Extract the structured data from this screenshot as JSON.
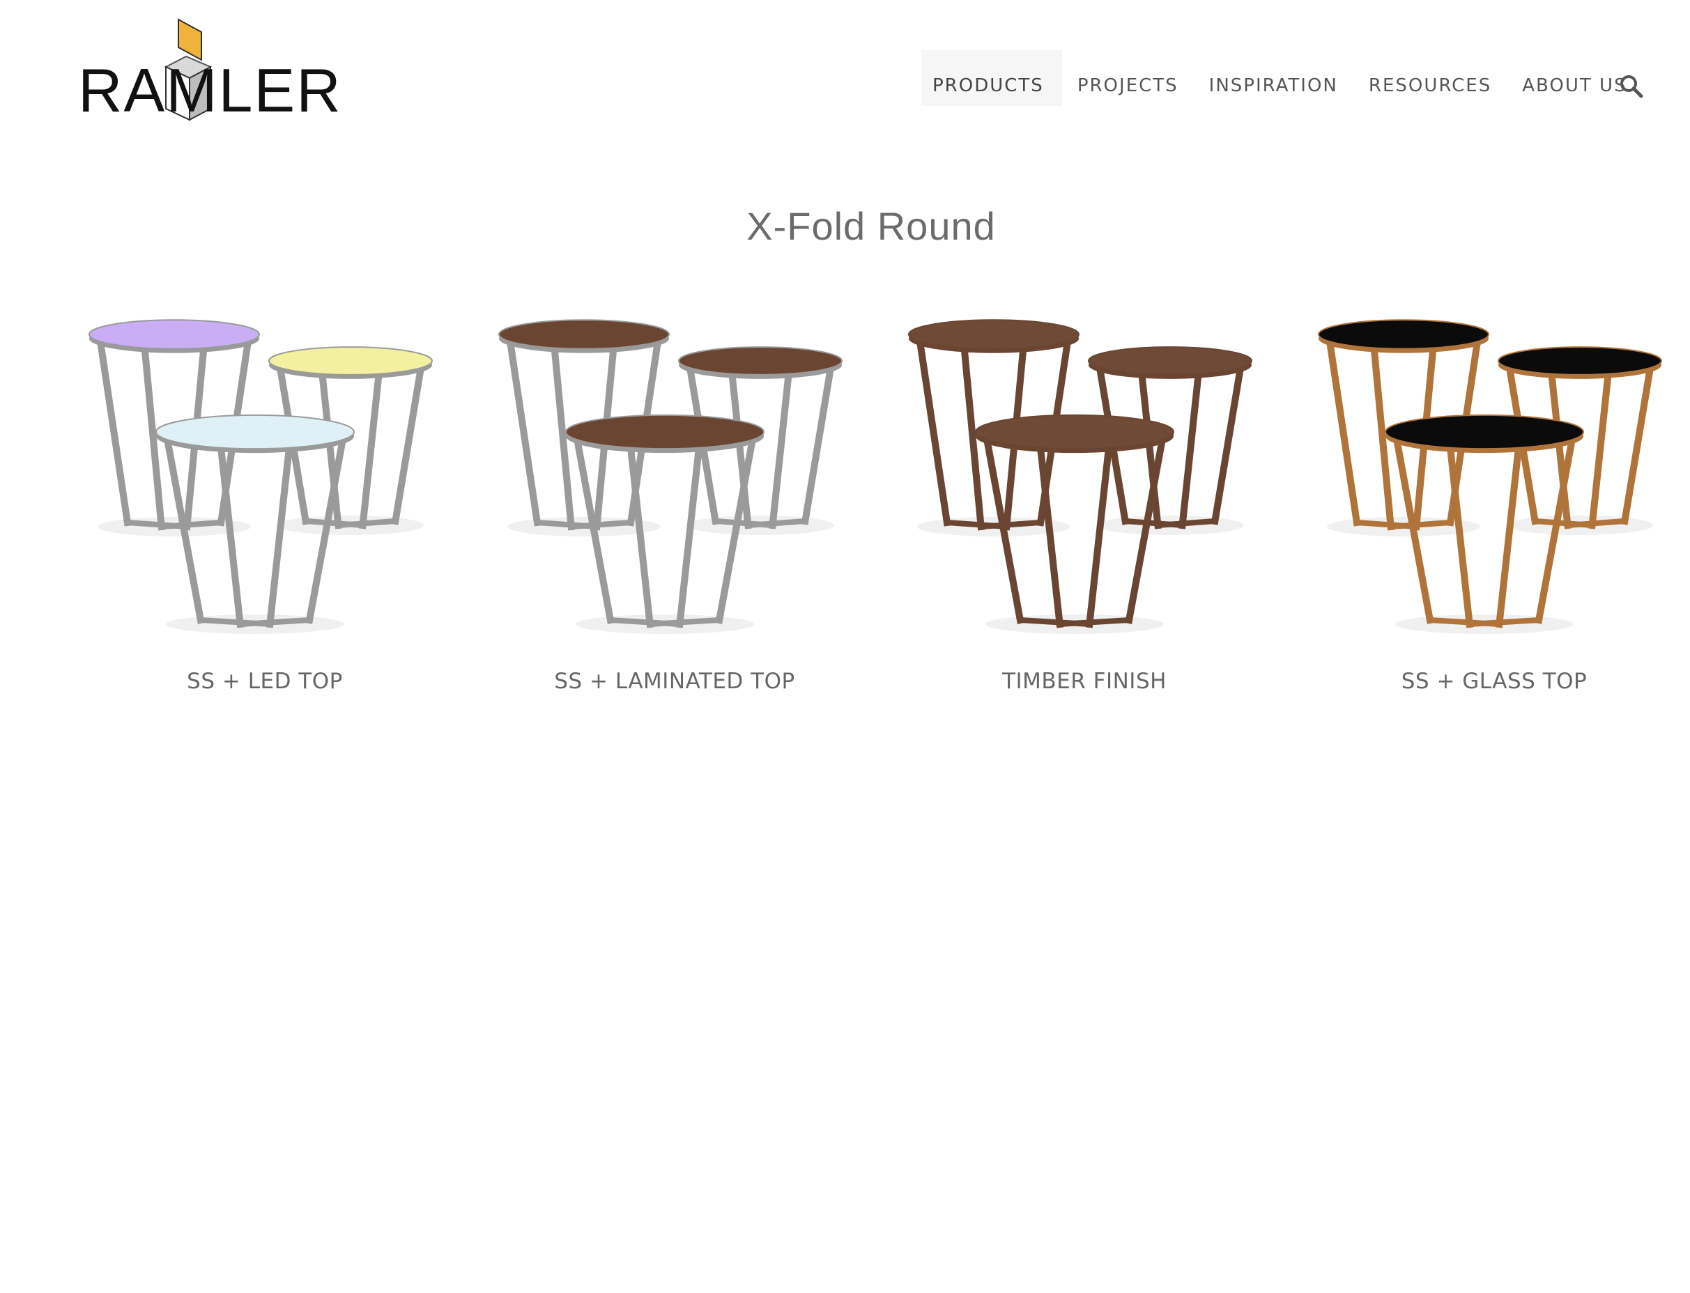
{
  "brand": {
    "name": "RAMLER",
    "accent": "#f1b23a"
  },
  "nav": {
    "items": [
      {
        "label": "PRODUCTS",
        "active": true
      },
      {
        "label": "PROJECTS",
        "active": false
      },
      {
        "label": "INSPIRATION",
        "active": false
      },
      {
        "label": "RESOURCES",
        "active": false
      },
      {
        "label": "ABOUT US",
        "active": false
      }
    ],
    "search_icon": "search-icon"
  },
  "page": {
    "title": "X-Fold Round"
  },
  "products": [
    {
      "label": "SS + LED TOP",
      "frame_color": "#9a9a9a",
      "top_colors": [
        "#c9aef5",
        "#f3f0a0",
        "#dff0f6"
      ]
    },
    {
      "label": "SS + LAMINATED TOP",
      "frame_color": "#9a9a9a",
      "top_colors": [
        "#6a4632",
        "#6a4632",
        "#6a4632"
      ]
    },
    {
      "label": "TIMBER FINISH",
      "frame_color": "#6a4632",
      "top_colors": [
        "#6f4a36",
        "#6f4a36",
        "#6f4a36"
      ]
    },
    {
      "label": "SS + GLASS TOP",
      "frame_color": "#b0743a",
      "top_colors": [
        "#0b0b0b",
        "#0b0b0b",
        "#0b0b0b"
      ]
    }
  ]
}
